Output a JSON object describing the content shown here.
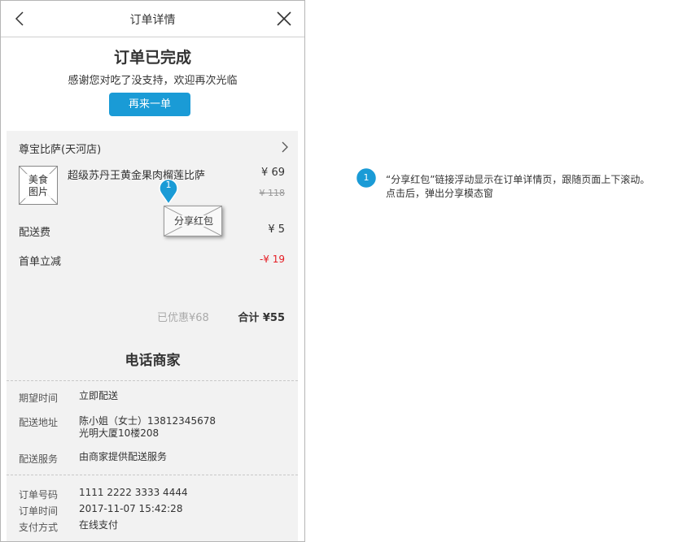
{
  "nav": {
    "title": "订单详情"
  },
  "status": {
    "title": "订单已完成",
    "subtitle": "感谢您对吃了没支持，欢迎再次光临",
    "reorder_label": "再来一单"
  },
  "store": {
    "name": "尊宝比萨(天河店)"
  },
  "item": {
    "image_label_line1": "美食",
    "image_label_line2": "图片",
    "name": "超级苏丹王黄金果肉榴莲比萨",
    "price": "¥ 69",
    "original_price": "¥ 118"
  },
  "fees": {
    "delivery_label": "配送费",
    "delivery_value": "¥ 5",
    "first_order_label": "首单立减",
    "first_order_value": "-¥ 19"
  },
  "summary": {
    "saved_text": "已优惠¥68",
    "total_text": "合计 ¥55"
  },
  "call_merchant": "电话商家",
  "delivery_info": {
    "time_label": "期望时间",
    "time_value": "立即配送",
    "address_label": "配送地址",
    "address_line1": "陈小姐（女士）13812345678",
    "address_line2": "光明大厦10楼208",
    "service_label": "配送服务",
    "service_value": "由商家提供配送服务"
  },
  "order_info": {
    "number_label": "订单号码",
    "number_value": "1111 2222 3333 4444",
    "time_label": "订单时间",
    "time_value": "2017-11-07 15:42:28",
    "payment_label": "支付方式",
    "payment_value": "在线支付"
  },
  "share": {
    "label": "分享红包"
  },
  "annotation": {
    "marker": "1",
    "line1": "“分享红包”链接浮动显示在订单详情页，跟随页面上下滚动。",
    "line2": "点击后，弹出分享模态窗"
  },
  "colors": {
    "accent": "#1a9bd6",
    "discount": "#e51c23",
    "panel": "#f2f2f2",
    "marker": "#1a9bd6"
  },
  "icons": [
    "back-arrow-icon",
    "close-icon",
    "chevron-right-icon",
    "image-placeholder-icon",
    "envelope-icon",
    "marker-pin-icon"
  ]
}
